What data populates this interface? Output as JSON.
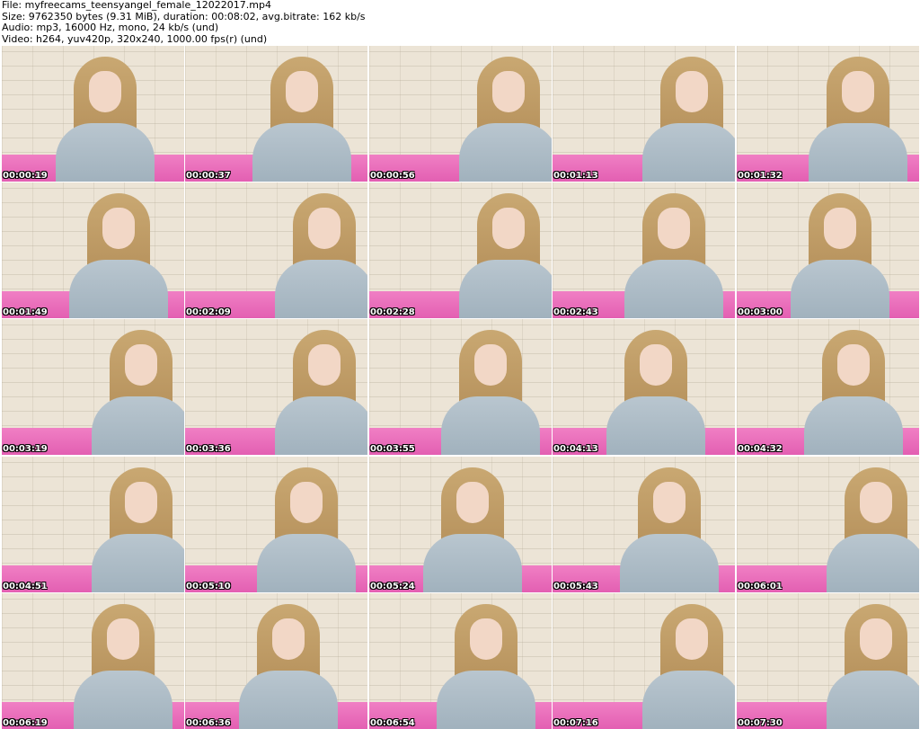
{
  "header": {
    "file": "File: myfreecams_teensyangel_female_12022017.mp4",
    "size": "Size: 9762350 bytes (9.31 MiB), duration: 00:08:02, avg.bitrate: 162 kb/s",
    "audio": "Audio: mp3, 16000 Hz, mono, 24 kb/s (und)",
    "video": "Video: h264, yuv420p, 320x240, 1000.00 fps(r) (und)"
  },
  "thumbnails": [
    {
      "timestamp": "00:00:19"
    },
    {
      "timestamp": "00:00:37"
    },
    {
      "timestamp": "00:00:56"
    },
    {
      "timestamp": "00:01:13"
    },
    {
      "timestamp": "00:01:32"
    },
    {
      "timestamp": "00:01:49"
    },
    {
      "timestamp": "00:02:09"
    },
    {
      "timestamp": "00:02:28"
    },
    {
      "timestamp": "00:02:43"
    },
    {
      "timestamp": "00:03:00"
    },
    {
      "timestamp": "00:03:19"
    },
    {
      "timestamp": "00:03:36"
    },
    {
      "timestamp": "00:03:55"
    },
    {
      "timestamp": "00:04:13"
    },
    {
      "timestamp": "00:04:32"
    },
    {
      "timestamp": "00:04:51"
    },
    {
      "timestamp": "00:05:10"
    },
    {
      "timestamp": "00:05:24"
    },
    {
      "timestamp": "00:05:43"
    },
    {
      "timestamp": "00:06:01"
    },
    {
      "timestamp": "00:06:19"
    },
    {
      "timestamp": "00:06:36"
    },
    {
      "timestamp": "00:06:54"
    },
    {
      "timestamp": "00:07:16"
    },
    {
      "timestamp": "00:07:30"
    }
  ]
}
